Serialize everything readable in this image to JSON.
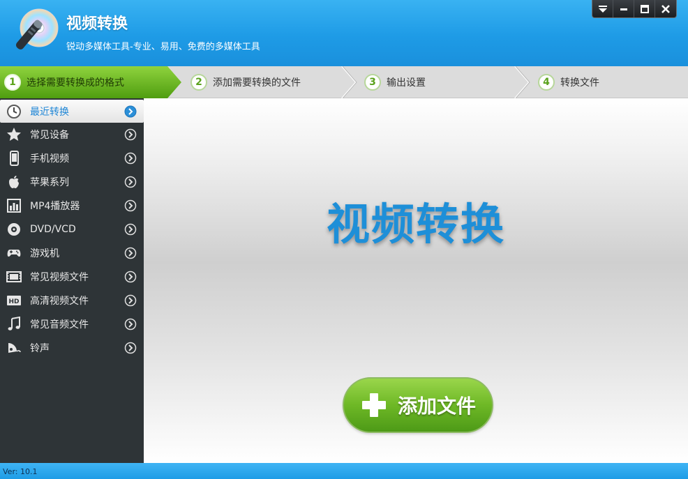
{
  "header": {
    "title": "视频转换",
    "subtitle": "锐动多媒体工具-专业、易用、免费的多媒体工具"
  },
  "window_controls": [
    "menu-icon",
    "minimize-icon",
    "maximize-icon",
    "close-icon"
  ],
  "steps": [
    {
      "num": "1",
      "label": "选择需要转换成的格式",
      "active": true
    },
    {
      "num": "2",
      "label": "添加需要转换的文件",
      "active": false
    },
    {
      "num": "3",
      "label": "输出设置",
      "active": false
    },
    {
      "num": "4",
      "label": "转换文件",
      "active": false
    }
  ],
  "sidebar": {
    "items": [
      {
        "label": "最近转换",
        "icon": "clock-icon",
        "active": true
      },
      {
        "label": "常见设备",
        "icon": "star-icon"
      },
      {
        "label": "手机视频",
        "icon": "phone-icon"
      },
      {
        "label": "苹果系列",
        "icon": "apple-icon"
      },
      {
        "label": "MP4播放器",
        "icon": "mp4-player-icon"
      },
      {
        "label": "DVD/VCD",
        "icon": "disc-icon"
      },
      {
        "label": "游戏机",
        "icon": "gamepad-icon"
      },
      {
        "label": "常见视频文件",
        "icon": "film-icon"
      },
      {
        "label": "高清视频文件",
        "icon": "hd-icon"
      },
      {
        "label": "常见音频文件",
        "icon": "music-note-icon"
      },
      {
        "label": "铃声",
        "icon": "ringtone-icon"
      }
    ]
  },
  "main": {
    "hero_text": "视频转换",
    "add_button_label": "添加文件"
  },
  "footer": {
    "version": "Ver: 10.1"
  },
  "colors": {
    "accent_blue": "#1e9be6",
    "active_step_green": "#6eb826",
    "sidebar_bg": "#2e3437",
    "hero_text": "#1e8fd8"
  }
}
